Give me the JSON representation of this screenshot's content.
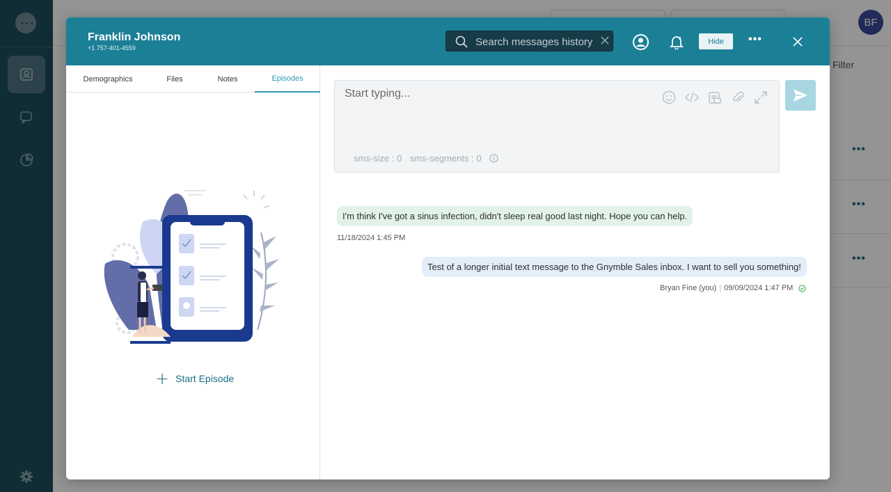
{
  "app": {
    "user_initials": "BF",
    "background_filter_label": "Filter"
  },
  "contact": {
    "name": "Franklin Johnson",
    "phone": "+1 757-401-4559"
  },
  "header": {
    "search_placeholder": "Search messages history",
    "hide_label": "Hide"
  },
  "tabs": [
    {
      "label": "Demographics",
      "active": false
    },
    {
      "label": "Files",
      "active": false
    },
    {
      "label": "Notes",
      "active": false
    },
    {
      "label": "Episodes",
      "active": true
    }
  ],
  "episodes": {
    "start_label": "Start Episode"
  },
  "composer": {
    "placeholder": "Start typing...",
    "sms_size": "sms-size : 0",
    "sms_segments": "sms-segments : 0"
  },
  "messages": [
    {
      "direction": "inbound",
      "text": "I'm think I've got a sinus infection, didn't sleep real good last night. Hope you can help.",
      "timestamp": "11/18/2024 1:45 PM"
    },
    {
      "direction": "outbound",
      "text": "Test of a longer initial text message to the Gnymble Sales inbox. I want to sell you something!",
      "sender": "Bryan Fine (you)",
      "timestamp": "09/09/2024 1:47 PM",
      "status": "delivered"
    }
  ],
  "colors": {
    "header": "#1b7f96",
    "sidebar": "#1d4e5e",
    "inbound_bubble": "#e1f3e9",
    "outbound_bubble": "#e4eefb",
    "accent": "#2f9ab5"
  }
}
